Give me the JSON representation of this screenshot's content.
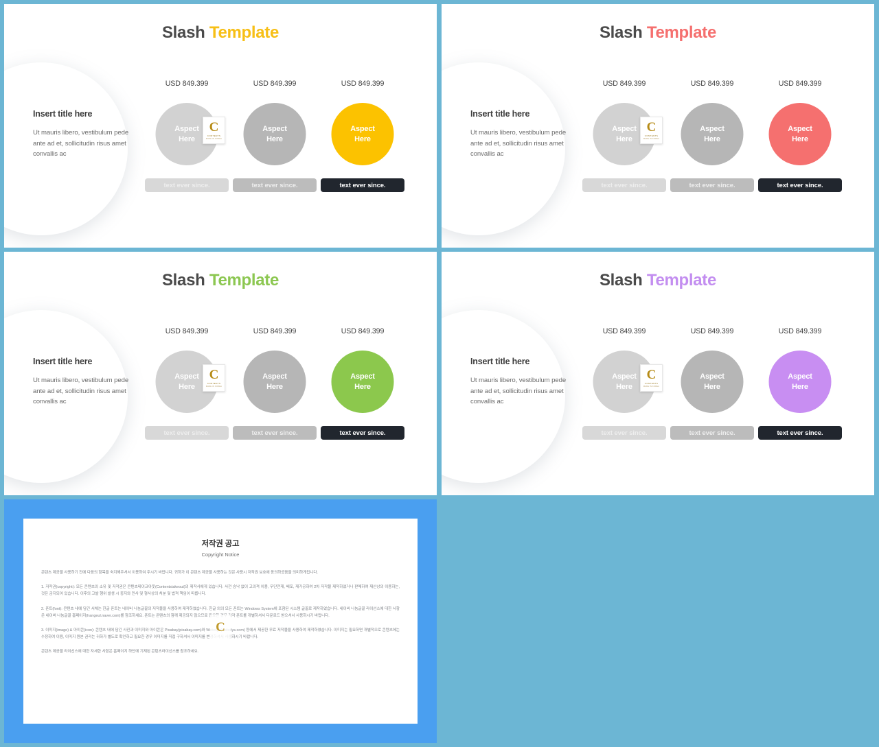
{
  "canvas": {
    "background": "#6cb6d4"
  },
  "slides": [
    {
      "id": "slide-yellow",
      "title_dark": "Slash ",
      "title_accent": "Template",
      "accent_color": "#fcc200",
      "left": {
        "title": "Insert title here",
        "body": "Ut mauris  libero, vestibulum pede ante ad et, sollicitudin risus amet convallis ac"
      },
      "columns": [
        {
          "price": "USD 849.399",
          "orb_label_1": "Aspect",
          "orb_label_2": "Here",
          "chip": "text ever since."
        },
        {
          "price": "USD 849.399",
          "orb_label_1": "Aspect",
          "orb_label_2": "Here",
          "chip": "text ever since."
        },
        {
          "price": "USD 849.399",
          "orb_label_1": "Aspect",
          "orb_label_2": "Here",
          "chip": "text ever since."
        }
      ]
    },
    {
      "id": "slide-red",
      "title_dark": "Slash ",
      "title_accent": "Template",
      "accent_color": "#f5706f",
      "left": {
        "title": "Insert title here",
        "body": "Ut mauris  libero, vestibulum pede ante ad et, sollicitudin risus amet convallis ac"
      },
      "columns": [
        {
          "price": "USD 849.399",
          "orb_label_1": "Aspect",
          "orb_label_2": "Here",
          "chip": "text ever since."
        },
        {
          "price": "USD 849.399",
          "orb_label_1": "Aspect",
          "orb_label_2": "Here",
          "chip": "text ever since."
        },
        {
          "price": "USD 849.399",
          "orb_label_1": "Aspect",
          "orb_label_2": "Here",
          "chip": "text ever since."
        }
      ]
    },
    {
      "id": "slide-green",
      "title_dark": "Slash ",
      "title_accent": "Template",
      "accent_color": "#8cc84d",
      "left": {
        "title": "Insert title here",
        "body": "Ut mauris  libero, vestibulum pede ante ad et, sollicitudin risus amet convallis ac"
      },
      "columns": [
        {
          "price": "USD 849.399",
          "orb_label_1": "Aspect",
          "orb_label_2": "Here",
          "chip": "text ever since."
        },
        {
          "price": "USD 849.399",
          "orb_label_1": "Aspect",
          "orb_label_2": "Here",
          "chip": "text ever since."
        },
        {
          "price": "USD 849.399",
          "orb_label_1": "Aspect",
          "orb_label_2": "Here",
          "chip": "text ever since."
        }
      ]
    },
    {
      "id": "slide-purple",
      "title_dark": "Slash ",
      "title_accent": "Template",
      "accent_color": "#c88ef2",
      "left": {
        "title": "Insert title here",
        "body": "Ut mauris  libero, vestibulum pede ante ad et, sollicitudin risus amet convallis ac"
      },
      "columns": [
        {
          "price": "USD 849.399",
          "orb_label_1": "Aspect",
          "orb_label_2": "Here",
          "chip": "text ever since."
        },
        {
          "price": "USD 849.399",
          "orb_label_1": "Aspect",
          "orb_label_2": "Here",
          "chip": "text ever since."
        },
        {
          "price": "USD 849.399",
          "orb_label_1": "Aspect",
          "orb_label_2": "Here",
          "chip": "text ever since."
        }
      ]
    }
  ],
  "badge": {
    "letter": "C",
    "line1": "CONTENTS",
    "line2": "MADE IN KOREA"
  },
  "document": {
    "heading_ko": "저작권 공고",
    "heading_en": "Copyright Notice",
    "paragraphs": [
      "콘텐츠 제공물 사용하기 전에 다음의 항목을 숙지해주셔서 이용하여 주시기 바랍니다. 귀하가 이 콘텐츠 제공물 사용하는 것은 사용시 저작권 보호에 동의하셨음을 의미하게됩니다.",
      "1. 저작권(copyright): 모든 콘텐츠의 소유 및 저작권은 콘텐츠테이크아웃(Contentstakeout)의 제작사에게 있습니다. 사전 승낙 없이 고의적 이용, 무단전재, 배포, 재가공하여 2차 저작물 제작하였거나 판매하여 재산상의 이용하는, 것은 금지되어 있습니다. 이후의 고발 행위 발생 시 중지와 민사 및 형사상의 처분 및 법적 책임이 따릅니다.",
      "2. 폰트(font): 콘텐츠 내에 담긴 서체는 한글 폰트는 네이버 나눔글꼴의 저작물을 사용하여 제작하였습니다. 한글 외의 모든 폰트는 Windows System에 포함된 시스템 글꼴로 제작하였습니다. 네이버 나눔글꼴 라이선스에 대한 사항은 네이버 나눔글꼴 홈페이지(hangeul.naver.com)를 참조하세요. 폰트는 콘텐츠의 함께 제공되지 않으므로 필요한 경우 각각 폰트를 개별하셔서 다운로드 받으셔서 사용하시기 바랍니다.",
      "3. 이미지(image) & 아이콘(icon): 콘텐츠 내에 담긴 사진과 이미지와 아이콘은 Pixabay(pixabay.com)와 Webolys(webolys.com) 등에서 제공한 무료 저작물을 사용하여 제작하였습니다. 이미지는 필요하면 개별적으로 콘텐츠에는 수정하여 이용, 이미지 원본 권리는 귀하가 별도로 확인하고 필요한 경우 이미지를 직접 구하셔서 이미지를 변경하셔서 사용하시기 바랍니다.",
      "콘텐츠 제공물 라이선스에 대한 자세한 사항은 홈페이지 하단에 기재된 콘텐츠라이선스를 참조하세요."
    ]
  }
}
